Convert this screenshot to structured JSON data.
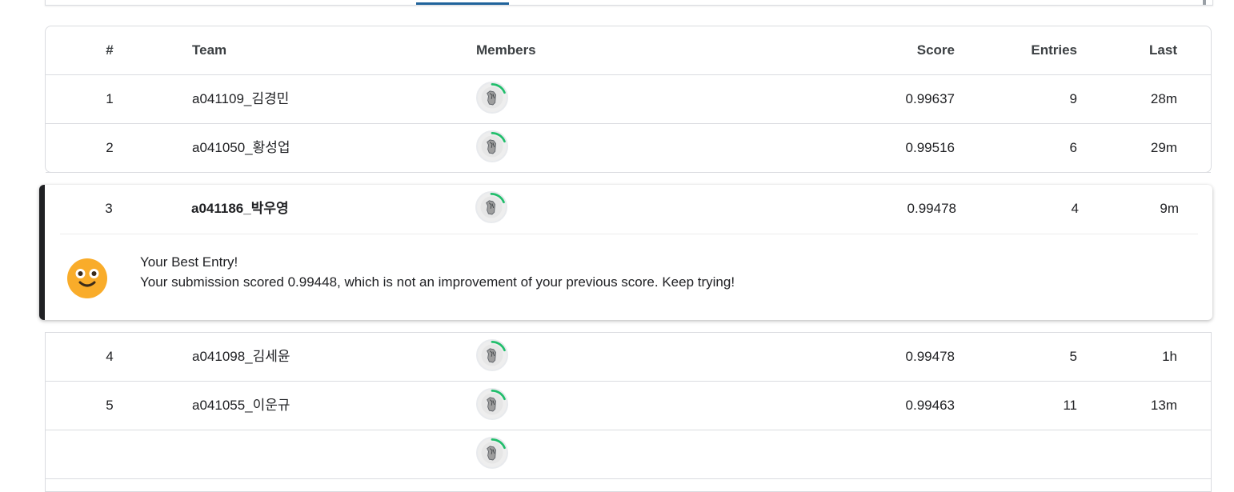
{
  "columns": {
    "rank": "#",
    "team": "Team",
    "members": "Members",
    "score": "Score",
    "entries": "Entries",
    "last": "Last"
  },
  "rows_top": [
    {
      "rank": "1",
      "team": "a041109_김경민",
      "score": "0.99637",
      "entries": "9",
      "last": "28m"
    },
    {
      "rank": "2",
      "team": "a041050_황성업",
      "score": "0.99516",
      "entries": "6",
      "last": "29m"
    }
  ],
  "highlight": {
    "rank": "3",
    "team": "a041186_박우영",
    "score": "0.99478",
    "entries": "4",
    "last": "9m",
    "message_title": "Your Best Entry!",
    "message_body": "Your submission scored 0.99448, which is not an improvement of your previous score. Keep trying!"
  },
  "rows_bottom": [
    {
      "rank": "4",
      "team": "a041098_김세윤",
      "score": "0.99478",
      "entries": "5",
      "last": "1h"
    },
    {
      "rank": "5",
      "team": "a041055_이운규",
      "score": "0.99463",
      "entries": "11",
      "last": "13m"
    }
  ],
  "colors": {
    "accent_bar": "#202124",
    "tab_underline": "#20639b",
    "progress_ring": "#20be6b",
    "emoji_face": "#f9ac2a"
  },
  "icons": {
    "avatar": "member-avatar-icon",
    "emoji": "smiley-face-icon"
  }
}
